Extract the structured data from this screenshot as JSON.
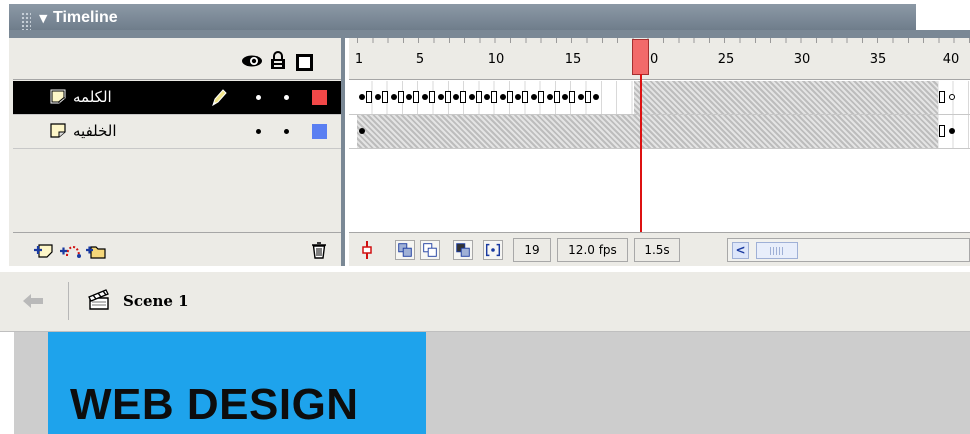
{
  "panel": {
    "title": "Timeline",
    "collapse_icon": "triangle-down-icon"
  },
  "layer_header": {
    "icons": [
      "eye-icon",
      "lock-icon",
      "outline-icon"
    ]
  },
  "layers": [
    {
      "name": "الكلمه",
      "selected": true,
      "edit_icon": "pencil-icon",
      "color": "#f24848"
    },
    {
      "name": "الخلفيه",
      "selected": false,
      "color": "#5a7ff2"
    }
  ],
  "layer_footer": {
    "icons": [
      "insert-layer-icon",
      "motion-guide-icon",
      "insert-folder-icon",
      "trash-icon"
    ]
  },
  "ruler": {
    "labels": [
      "1",
      "5",
      "10",
      "15",
      "20",
      "25",
      "30",
      "35",
      "40"
    ]
  },
  "frames": {
    "current_frame": "19",
    "frame_rate": "12.0 fps",
    "elapsed_time": "1.5s"
  },
  "colors": {
    "panel_header": "#7a8895",
    "selected_layer": "#000000",
    "playhead": "#f26a6a",
    "stage_canvas": "#1ea3ec"
  },
  "edit_bar": {
    "scene_label": "Scene 1"
  },
  "stage": {
    "text": "WEB DESIGN"
  }
}
